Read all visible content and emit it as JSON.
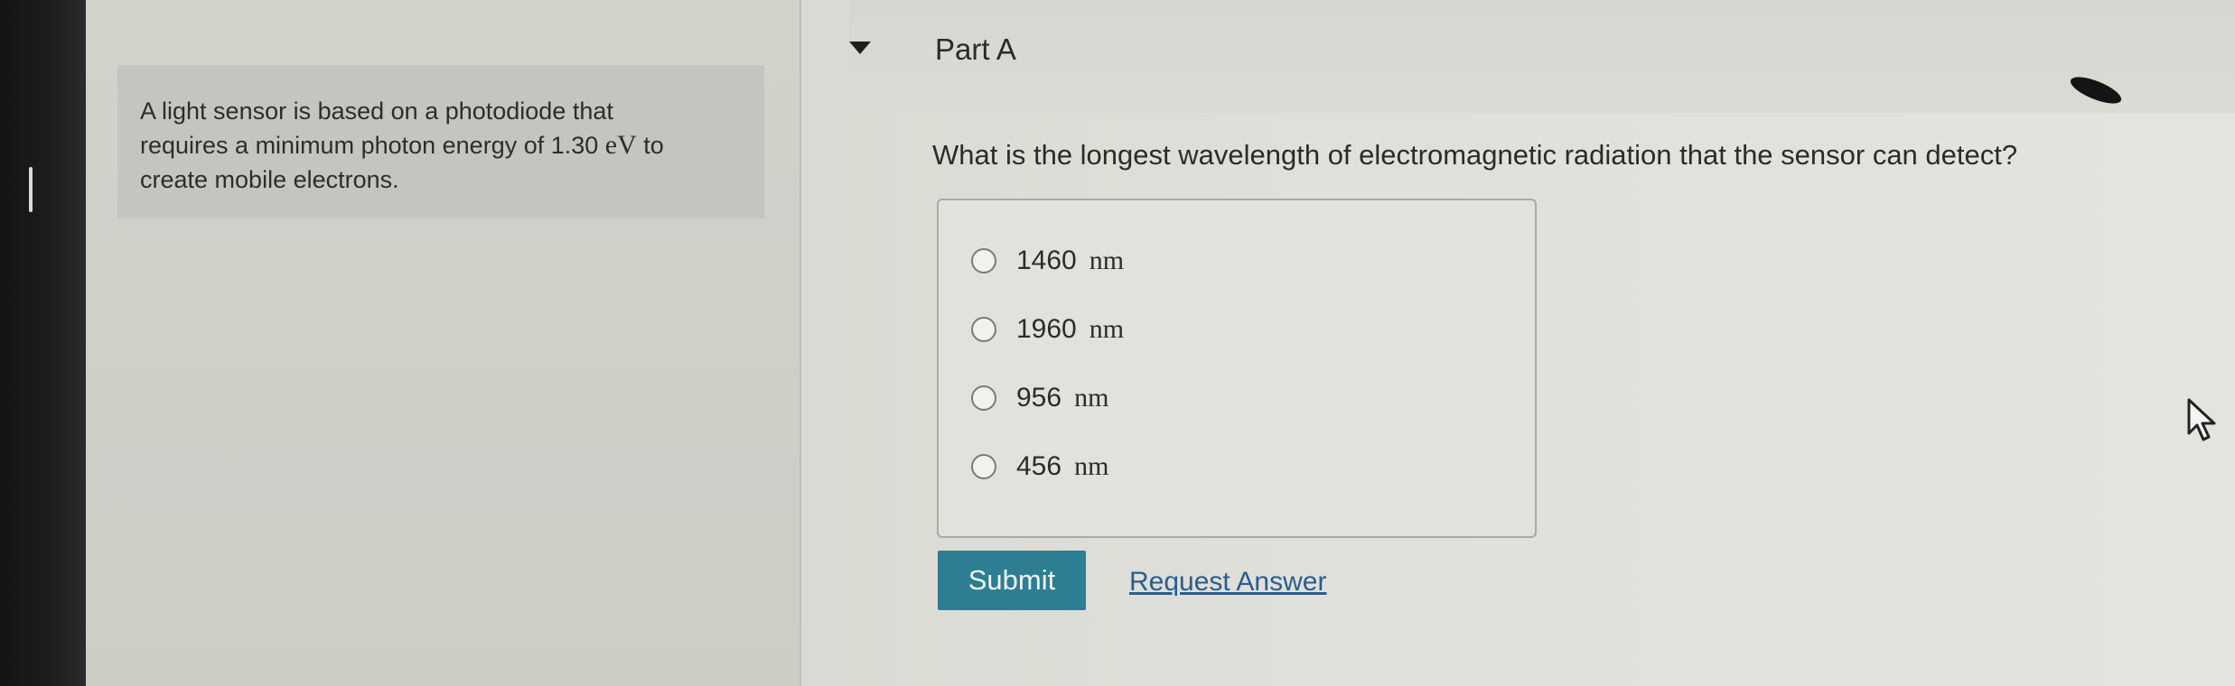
{
  "intro": {
    "line1": "A light sensor is based on a photodiode that",
    "line2_prefix": "requires a minimum photon energy of 1.30",
    "line2_unit": "eV",
    "line2_suffix": "to",
    "line3": "create mobile electrons."
  },
  "part": {
    "title": "Part A"
  },
  "question": "What is the longest wavelength of electromagnetic radiation that the sensor can detect?",
  "options": [
    {
      "value": "1460",
      "unit": "nm"
    },
    {
      "value": "1960",
      "unit": "nm"
    },
    {
      "value": "956",
      "unit": "nm"
    },
    {
      "value": "456",
      "unit": "nm"
    }
  ],
  "buttons": {
    "submit": "Submit",
    "request_answer": "Request Answer"
  },
  "colors": {
    "submit_bg": "#2d7e93",
    "link": "#2a5d8f"
  }
}
